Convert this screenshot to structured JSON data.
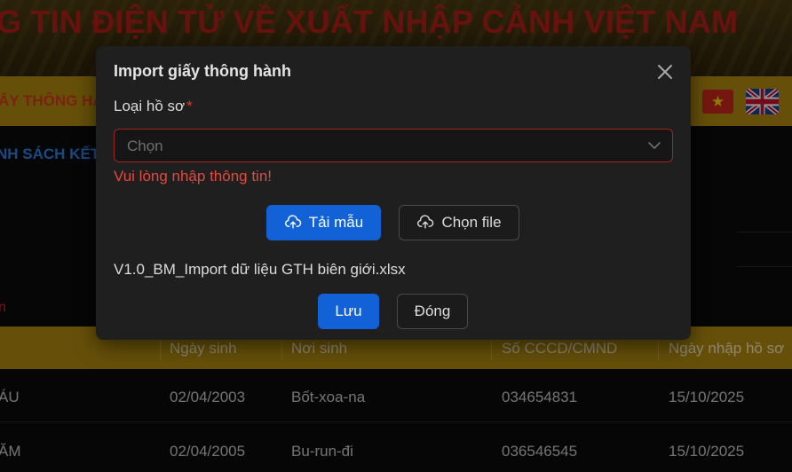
{
  "page": {
    "banner_title": "G TIN ĐIỆN TỬ VỀ XUẤT NHẬP CẢNH VIỆT NAM",
    "nav_item": "ẤY THÔNG HÀ",
    "section_link": "NH SÁCH KẾT",
    "red_mark": "n",
    "flag_star": "★",
    "language_flags": [
      "vietnam-flag",
      "uk-flag"
    ]
  },
  "table": {
    "columns": [
      "Ngày sinh",
      "Nơi sinh",
      "Số CCCD/CMND",
      "Ngày nhập hồ sơ"
    ],
    "rows": [
      {
        "name": "ÁU",
        "dob": "02/04/2003",
        "place": "Bốt-xoa-na",
        "id": "034654831",
        "date": "15/10/2025"
      },
      {
        "name": "ĂM",
        "dob": "02/04/2005",
        "place": "Bu-run-đi",
        "id": "036546545",
        "date": "15/10/2025"
      }
    ]
  },
  "modal": {
    "title": "Import giấy thông hành",
    "field_label": "Loại hồ sơ",
    "required_mark": "*",
    "select_placeholder": "Chọn",
    "error_text": "Vui lòng nhập thông tin!",
    "download_template_label": "Tải mẫu",
    "choose_file_label": "Chọn file",
    "file_name": "V1.0_BM_Import dữ liệu GTH biên giới.xlsx",
    "save_label": "Lưu",
    "close_label": "Đóng"
  },
  "colors": {
    "primary": "#1261d6",
    "error": "#e3342f",
    "header_gold": "#b08a10",
    "banner_red": "#b3201a"
  }
}
